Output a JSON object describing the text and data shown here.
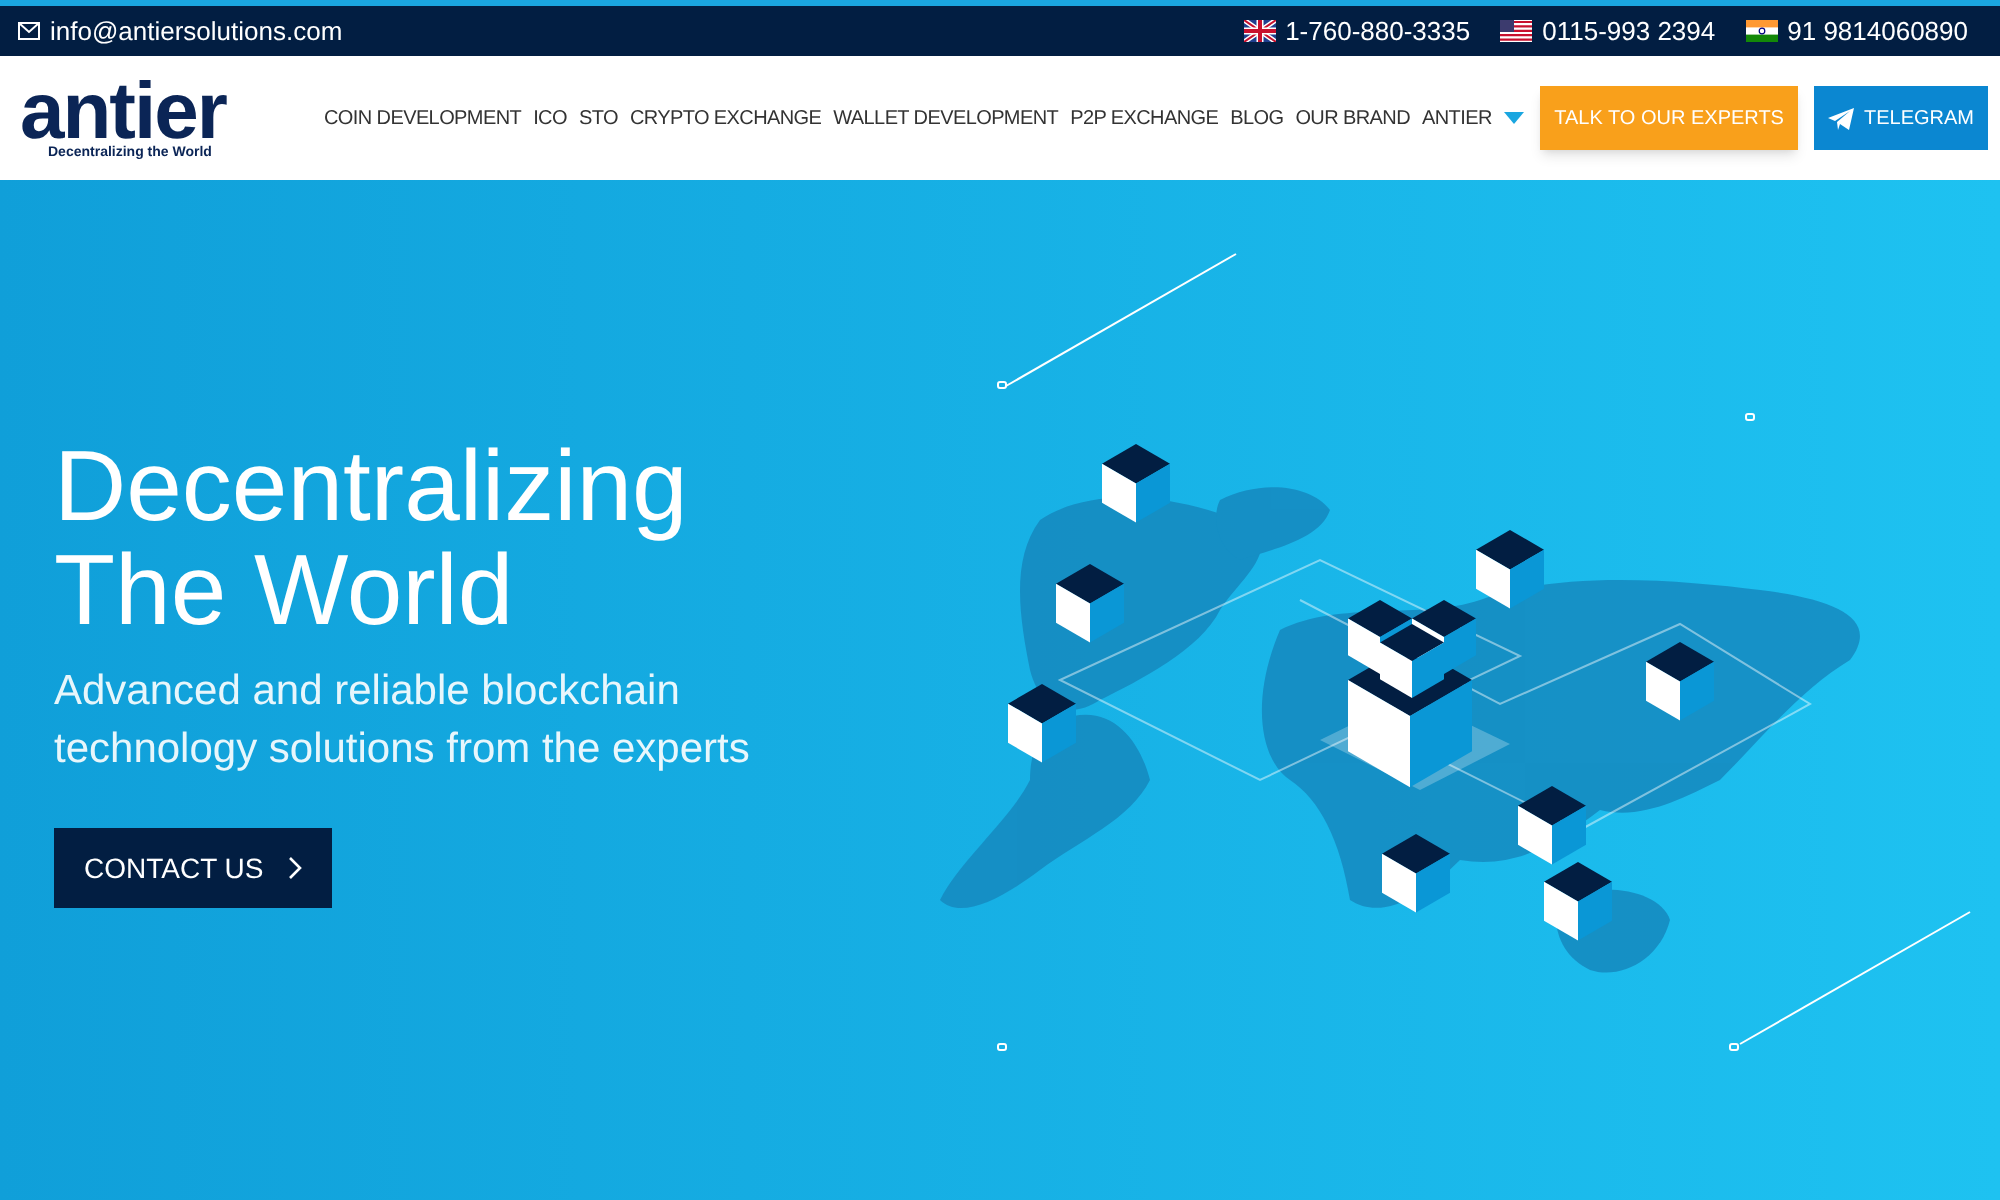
{
  "top_bar": {
    "email": "info@antiersolutions.com",
    "phones": [
      {
        "kind": "uk",
        "number": "1-760-880-3335"
      },
      {
        "kind": "us",
        "number": "0115-993 2394"
      },
      {
        "kind": "in",
        "number": "91 9814060890"
      }
    ]
  },
  "logo": {
    "name": "antier",
    "tagline": "Decentralizing the World"
  },
  "nav": [
    {
      "label": "COIN DEVELOPMENT",
      "dropdown": false
    },
    {
      "label": "ICO",
      "dropdown": false
    },
    {
      "label": "STO",
      "dropdown": false
    },
    {
      "label": "CRYPTO EXCHANGE",
      "dropdown": false
    },
    {
      "label": "WALLET DEVELOPMENT",
      "dropdown": false
    },
    {
      "label": "P2P EXCHANGE",
      "dropdown": false
    },
    {
      "label": "BLOG",
      "dropdown": false
    },
    {
      "label": "OUR BRAND",
      "dropdown": false
    },
    {
      "label": "ANTIER",
      "dropdown": true
    }
  ],
  "buttons": [
    {
      "kind": "experts",
      "label": "TALK TO OUR EXPERTS"
    },
    {
      "kind": "telegram",
      "label": "TELEGRAM"
    }
  ],
  "hero": {
    "title_lines": [
      "Decentralizing",
      "The World"
    ],
    "subtitle": "Advanced and reliable blockchain technology solutions from the experts",
    "cta": "CONTACT US"
  }
}
